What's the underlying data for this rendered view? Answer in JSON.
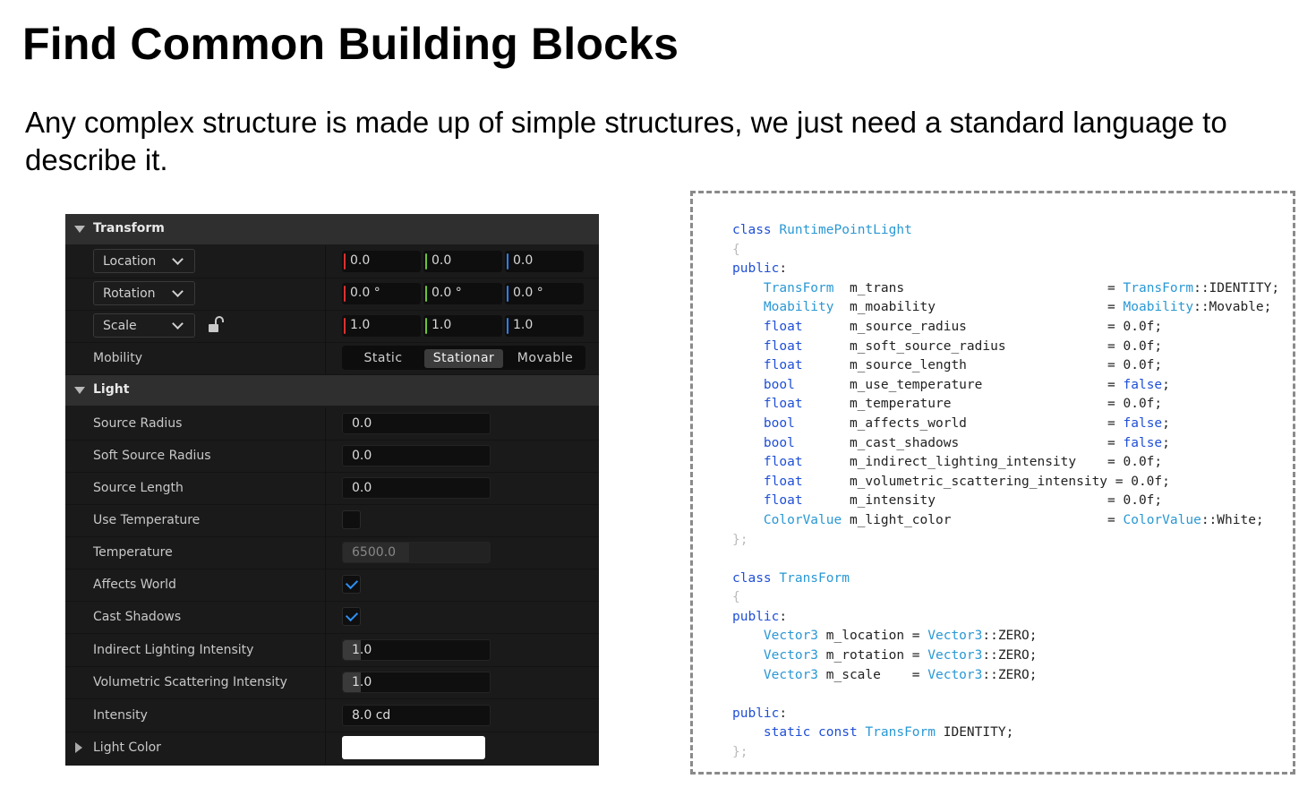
{
  "title": "Find Common Building Blocks",
  "subtitle": "Any complex structure is made up of simple structures, we just need a standard language to describe it.",
  "panel": {
    "transform_section": "Transform",
    "light_section": "Light",
    "location": {
      "label": "Location",
      "x": "0.0",
      "y": "0.0",
      "z": "0.0"
    },
    "rotation": {
      "label": "Rotation",
      "x": "0.0 °",
      "y": "0.0 °",
      "z": "0.0 °"
    },
    "scale": {
      "label": "Scale",
      "x": "1.0",
      "y": "1.0",
      "z": "1.0"
    },
    "mobility": {
      "label": "Mobility",
      "options": [
        "Static",
        "Stationar",
        "Movable"
      ],
      "selected": "Stationar"
    },
    "source_radius": {
      "label": "Source Radius",
      "value": "0.0"
    },
    "soft_source_radius": {
      "label": "Soft Source Radius",
      "value": "0.0"
    },
    "source_length": {
      "label": "Source Length",
      "value": "0.0"
    },
    "use_temperature": {
      "label": "Use Temperature",
      "checked": false
    },
    "temperature": {
      "label": "Temperature",
      "value": "6500.0"
    },
    "affects_world": {
      "label": "Affects World",
      "checked": true
    },
    "cast_shadows": {
      "label": "Cast Shadows",
      "checked": true
    },
    "indirect_lighting_intensity": {
      "label": "Indirect Lighting Intensity",
      "value": "1.0"
    },
    "volumetric_scattering_intensity": {
      "label": "Volumetric Scattering Intensity",
      "value": "1.0"
    },
    "intensity": {
      "label": "Intensity",
      "value": "8.0 cd"
    },
    "light_color": {
      "label": "Light Color",
      "color": "#ffffff"
    },
    "axis_colors": {
      "x": "#e03030",
      "y": "#6ec23a",
      "z": "#2f7fe8"
    }
  },
  "code": {
    "lines": [
      [
        [
          "kw",
          "class "
        ],
        [
          "ty",
          "RuntimePointLight"
        ]
      ],
      [
        [
          "gu",
          "{"
        ]
      ],
      [
        [
          "kw",
          "public"
        ],
        [
          "pl",
          ":"
        ]
      ],
      [
        [
          "pl",
          "    "
        ],
        [
          "ty",
          "TransForm"
        ],
        [
          "pl",
          "  m_trans                          = "
        ],
        [
          "ty",
          "TransForm"
        ],
        [
          "pl",
          "::IDENTITY;"
        ]
      ],
      [
        [
          "pl",
          "    "
        ],
        [
          "ty",
          "Moability"
        ],
        [
          "pl",
          "  m_moability                      = "
        ],
        [
          "ty",
          "Moability"
        ],
        [
          "pl",
          "::Movable;"
        ]
      ],
      [
        [
          "pl",
          "    "
        ],
        [
          "kw",
          "float"
        ],
        [
          "pl",
          "      m_source_radius                  = 0.0f;"
        ]
      ],
      [
        [
          "pl",
          "    "
        ],
        [
          "kw",
          "float"
        ],
        [
          "pl",
          "      m_soft_source_radius             = 0.0f;"
        ]
      ],
      [
        [
          "pl",
          "    "
        ],
        [
          "kw",
          "float"
        ],
        [
          "pl",
          "      m_source_length                  = 0.0f;"
        ]
      ],
      [
        [
          "pl",
          "    "
        ],
        [
          "kw",
          "bool"
        ],
        [
          "pl",
          "       m_use_temperature                = "
        ],
        [
          "kw",
          "false"
        ],
        [
          "pl",
          ";"
        ]
      ],
      [
        [
          "pl",
          "    "
        ],
        [
          "kw",
          "float"
        ],
        [
          "pl",
          "      m_temperature                    = 0.0f;"
        ]
      ],
      [
        [
          "pl",
          "    "
        ],
        [
          "kw",
          "bool"
        ],
        [
          "pl",
          "       m_affects_world                  = "
        ],
        [
          "kw",
          "false"
        ],
        [
          "pl",
          ";"
        ]
      ],
      [
        [
          "pl",
          "    "
        ],
        [
          "kw",
          "bool"
        ],
        [
          "pl",
          "       m_cast_shadows                   = "
        ],
        [
          "kw",
          "false"
        ],
        [
          "pl",
          ";"
        ]
      ],
      [
        [
          "pl",
          "    "
        ],
        [
          "kw",
          "float"
        ],
        [
          "pl",
          "      m_indirect_lighting_intensity    = 0.0f;"
        ]
      ],
      [
        [
          "pl",
          "    "
        ],
        [
          "kw",
          "float"
        ],
        [
          "pl",
          "      m_volumetric_scattering_intensity = 0.0f;"
        ]
      ],
      [
        [
          "pl",
          "    "
        ],
        [
          "kw",
          "float"
        ],
        [
          "pl",
          "      m_intensity                      = 0.0f;"
        ]
      ],
      [
        [
          "pl",
          "    "
        ],
        [
          "ty",
          "ColorValue"
        ],
        [
          "pl",
          " m_light_color                    = "
        ],
        [
          "ty",
          "ColorValue"
        ],
        [
          "pl",
          "::White;"
        ]
      ],
      [
        [
          "gu",
          "};"
        ]
      ],
      [],
      [
        [
          "kw",
          "class "
        ],
        [
          "ty",
          "TransForm"
        ]
      ],
      [
        [
          "gu",
          "{"
        ]
      ],
      [
        [
          "kw",
          "public"
        ],
        [
          "pl",
          ":"
        ]
      ],
      [
        [
          "pl",
          "    "
        ],
        [
          "ty",
          "Vector3"
        ],
        [
          "pl",
          " m_location = "
        ],
        [
          "ty",
          "Vector3"
        ],
        [
          "pl",
          "::ZERO;"
        ]
      ],
      [
        [
          "pl",
          "    "
        ],
        [
          "ty",
          "Vector3"
        ],
        [
          "pl",
          " m_rotation = "
        ],
        [
          "ty",
          "Vector3"
        ],
        [
          "pl",
          "::ZERO;"
        ]
      ],
      [
        [
          "pl",
          "    "
        ],
        [
          "ty",
          "Vector3"
        ],
        [
          "pl",
          " m_scale    = "
        ],
        [
          "ty",
          "Vector3"
        ],
        [
          "pl",
          "::ZERO;"
        ]
      ],
      [],
      [
        [
          "kw",
          "public"
        ],
        [
          "pl",
          ":"
        ]
      ],
      [
        [
          "pl",
          "    "
        ],
        [
          "kw",
          "static const "
        ],
        [
          "ty",
          "TransForm"
        ],
        [
          "pl",
          " IDENTITY;"
        ]
      ],
      [
        [
          "gu",
          "};"
        ]
      ]
    ]
  }
}
